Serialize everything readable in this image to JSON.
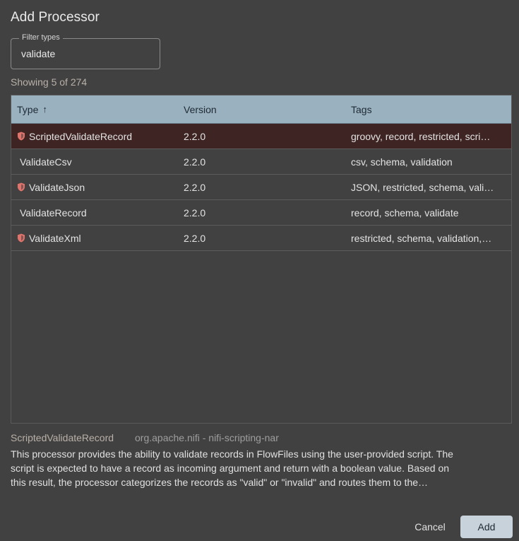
{
  "dialog": {
    "title": "Add Processor"
  },
  "filter": {
    "label": "Filter types",
    "value": "validate"
  },
  "results": {
    "count_text": "Showing 5 of 274"
  },
  "table": {
    "headers": {
      "type": "Type",
      "version": "Version",
      "tags": "Tags",
      "sort_indicator": "↑"
    },
    "rows": [
      {
        "type": "ScriptedValidateRecord",
        "version": "2.2.0",
        "tags": "groovy, record, restricted, scri…",
        "restricted": true,
        "selected": true
      },
      {
        "type": "ValidateCsv",
        "version": "2.2.0",
        "tags": "csv, schema, validation",
        "restricted": false,
        "selected": false
      },
      {
        "type": "ValidateJson",
        "version": "2.2.0",
        "tags": "JSON, restricted, schema, vali…",
        "restricted": true,
        "selected": false
      },
      {
        "type": "ValidateRecord",
        "version": "2.2.0",
        "tags": "record, schema, validate",
        "restricted": false,
        "selected": false
      },
      {
        "type": "ValidateXml",
        "version": "2.2.0",
        "tags": "restricted, schema, validation,…",
        "restricted": true,
        "selected": false
      }
    ]
  },
  "details": {
    "name": "ScriptedValidateRecord",
    "bundle": "org.apache.nifi - nifi-scripting-nar",
    "description_lines": [
      "This processor provides the ability to validate records in FlowFiles using the user-provided script. The",
      "script is expected to have a record as incoming argument and return with a boolean value. Based on",
      "this result, the processor categorizes the records as \"valid\" or \"invalid\" and routes them to the…"
    ]
  },
  "actions": {
    "cancel_label": "Cancel",
    "add_label": "Add"
  },
  "colors": {
    "background": "#414141",
    "header_bg": "#9ab1c0",
    "selected_row": "#3e2523",
    "restricted_icon": "#e0746c",
    "add_button": "#c7d2da"
  },
  "icons": {
    "restricted": "shield-icon"
  }
}
